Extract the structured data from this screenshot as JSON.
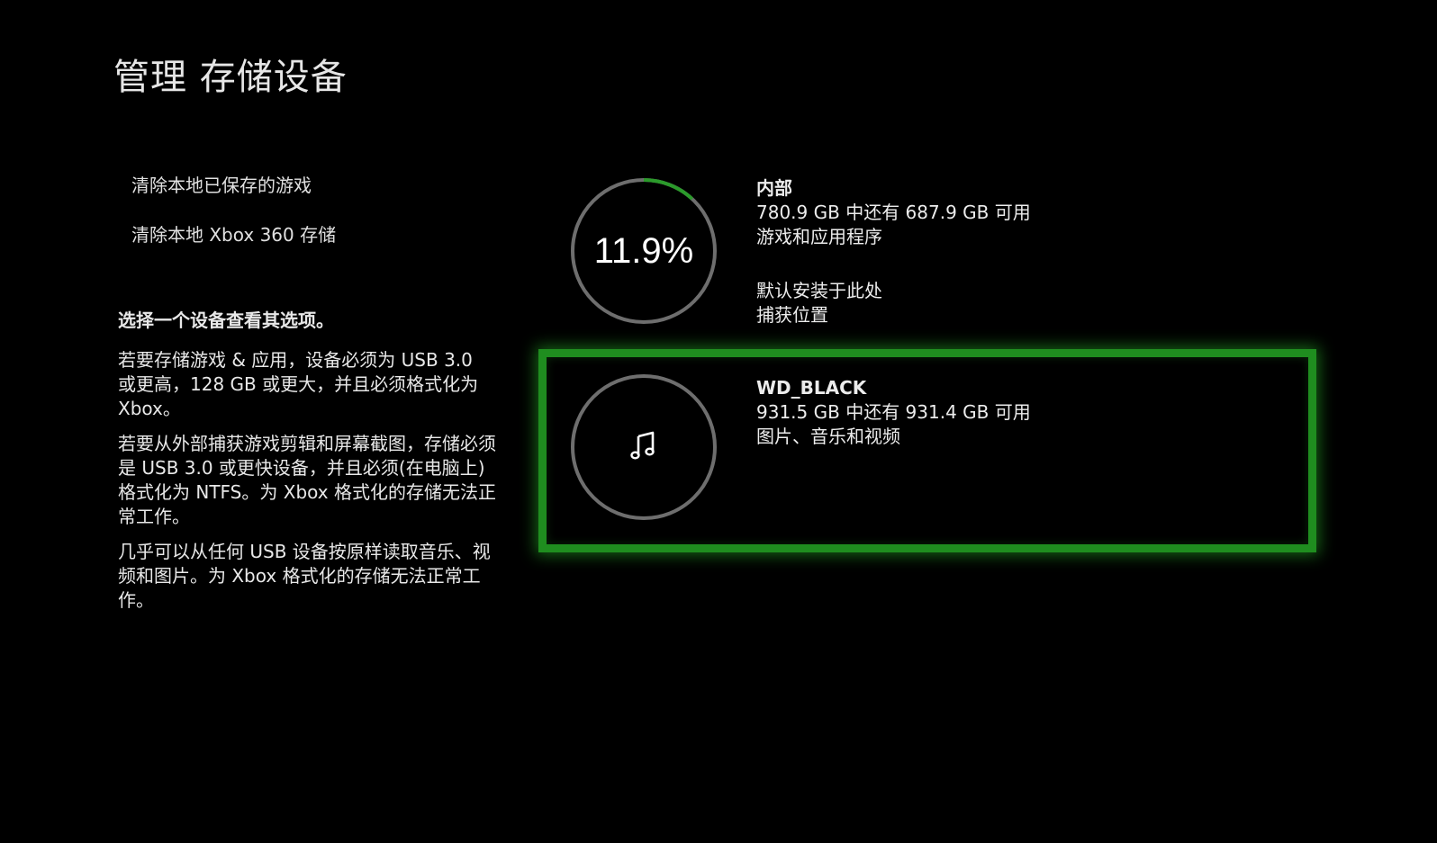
{
  "page_title": "管理 存储设备",
  "menu": [
    {
      "label": "清除本地已保存的游戏"
    },
    {
      "label": "清除本地 Xbox 360 存储"
    }
  ],
  "info": {
    "lead": "选择一个设备查看其选项。",
    "paragraphs": [
      "若要存储游戏 & 应用，设备必须为 USB 3.0 或更高，128 GB 或更大，并且必须格式化为 Xbox。",
      "若要从外部捕获游戏剪辑和屏幕截图，存储必须是 USB 3.0 或更快设备，并且必须(在电脑上)格式化为 NTFS。为 Xbox 格式化的存储无法正常工作。",
      "几乎可以从任何 USB 设备按原样读取音乐、视频和图片。为 Xbox 格式化的存储无法正常工作。"
    ]
  },
  "devices": {
    "internal": {
      "name": "内部",
      "capacity": "780.9 GB 中还有 687.9 GB 可用",
      "content": "游戏和应用程序",
      "flag1": "默认安装于此处",
      "flag2": "捕获位置",
      "used_percent_label": "11.9%",
      "used_fraction": 0.119
    },
    "external": {
      "name": "WD_BLACK",
      "capacity": "931.5 GB 中还有 931.4 GB 可用",
      "content": "图片、音乐和视频",
      "icon": "music-note-icon",
      "selected": true
    }
  },
  "colors": {
    "background": "#000000",
    "accent_green": "#1f8d1f",
    "ring_track": "#6e6e6e",
    "ring_fill": "#2b9a2b"
  }
}
